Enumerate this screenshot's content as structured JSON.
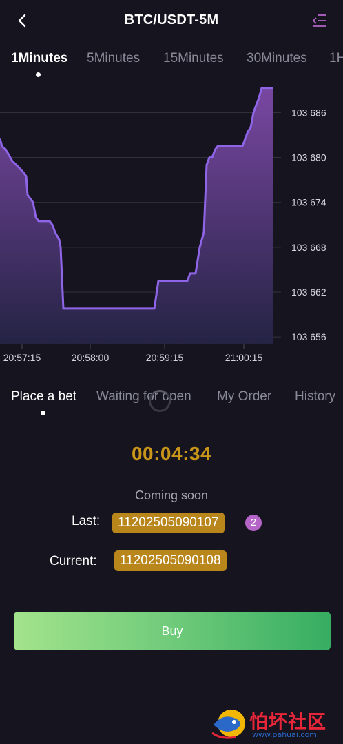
{
  "header": {
    "title": "BTC/USDT-5M"
  },
  "period_tabs": [
    {
      "label": "1Minutes",
      "active": true
    },
    {
      "label": "5Minutes",
      "active": false
    },
    {
      "label": "15Minutes",
      "active": false
    },
    {
      "label": "30Minutes",
      "active": false
    },
    {
      "label": "1H",
      "active": false
    }
  ],
  "chart_data": {
    "type": "area",
    "x_ticks": [
      "20:57:15",
      "20:58:00",
      "20:59:15",
      "21:00:15"
    ],
    "y_ticks": [
      "103 686",
      "103 680",
      "103 674",
      "103 668",
      "103 662",
      "103 656"
    ],
    "ylim": [
      103655,
      103690
    ],
    "series": [
      {
        "points": [
          [
            0,
            103682.5
          ],
          [
            3,
            103681.5
          ],
          [
            10,
            103680.8
          ],
          [
            18,
            103679.5
          ],
          [
            26,
            103678.8
          ],
          [
            34,
            103678
          ],
          [
            38,
            103677.5
          ],
          [
            40,
            103675
          ],
          [
            44,
            103674.5
          ],
          [
            48,
            103674
          ],
          [
            52,
            103672
          ],
          [
            56,
            103671.5
          ],
          [
            62,
            103671.5
          ],
          [
            72,
            103671.5
          ],
          [
            76,
            103671
          ],
          [
            80,
            103670
          ],
          [
            86,
            103669
          ],
          [
            88,
            103668
          ],
          [
            92,
            103659.8
          ],
          [
            100,
            103659.8
          ],
          [
            140,
            103659.8
          ],
          [
            180,
            103659.8
          ],
          [
            224,
            103659.8
          ],
          [
            226,
            103661
          ],
          [
            230,
            103663.5
          ],
          [
            250,
            103663.5
          ],
          [
            272,
            103663.5
          ],
          [
            276,
            103664.5
          ],
          [
            284,
            103664.5
          ],
          [
            290,
            103668
          ],
          [
            296,
            103670
          ],
          [
            300,
            103679
          ],
          [
            304,
            103680
          ],
          [
            308,
            103680
          ],
          [
            312,
            103681
          ],
          [
            316,
            103681.5
          ],
          [
            334,
            103681.5
          ],
          [
            352,
            103681.5
          ],
          [
            356,
            103682.5
          ],
          [
            360,
            103683.5
          ],
          [
            364,
            103684
          ],
          [
            368,
            103686
          ],
          [
            372,
            103687
          ],
          [
            376,
            103688
          ],
          [
            380,
            103689.3
          ],
          [
            396,
            103689.3
          ]
        ]
      }
    ],
    "colors": {
      "line": "#8f65e8",
      "fill_top": "#7e4aa8",
      "fill_bottom": "#252446"
    },
    "grid": true
  },
  "bet_tabs": [
    {
      "label": "Place a bet",
      "active": true
    },
    {
      "label": "Waiting for open",
      "active": false
    },
    {
      "label": "My Order",
      "active": false
    },
    {
      "label": "History",
      "active": false
    }
  ],
  "round": {
    "countdown": "00:04:34",
    "status": "Coming soon",
    "last_label": "Last:",
    "last_value": "11202505090107",
    "last_count": "2",
    "current_label": "Current:",
    "current_value": "11202505090108"
  },
  "buy_button": {
    "label": "Buy"
  },
  "watermark": {
    "text": "怕坏社区",
    "url": "www.pahuai.com"
  },
  "colors": {
    "background": "#15141f",
    "accent_gold": "#c9961a",
    "badge_gold": "#b8861b",
    "badge_purple": "#b565c8"
  }
}
